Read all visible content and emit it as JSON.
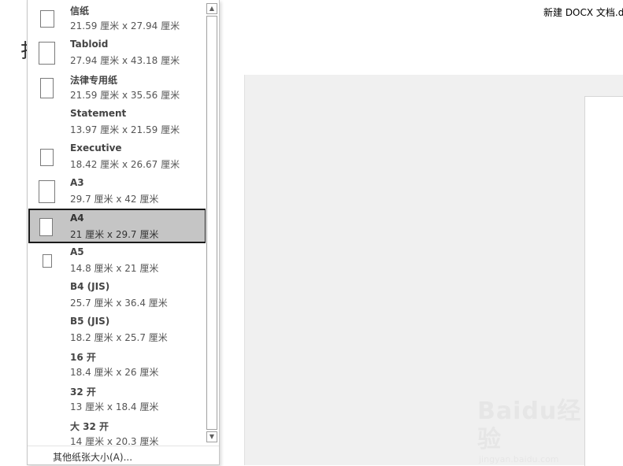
{
  "window": {
    "title": "新建 DOCX 文档.d"
  },
  "background": {
    "left_glyph": "打"
  },
  "paper_sizes": [
    {
      "name": "信纸",
      "size": "21.59 厘米 x 27.94 厘米",
      "selected": false
    },
    {
      "name": "Tabloid",
      "size": "27.94 厘米 x 43.18 厘米",
      "selected": false
    },
    {
      "name": "法律专用纸",
      "size": "21.59 厘米 x 35.56 厘米",
      "selected": false
    },
    {
      "name": "Statement",
      "size": "13.97 厘米 x 21.59 厘米",
      "selected": false
    },
    {
      "name": "Executive",
      "size": "18.42 厘米 x 26.67 厘米",
      "selected": false
    },
    {
      "name": "A3",
      "size": "29.7 厘米 x 42 厘米",
      "selected": false
    },
    {
      "name": "A4",
      "size": "21 厘米 x 29.7 厘米",
      "selected": true
    },
    {
      "name": "A5",
      "size": "14.8 厘米 x 21 厘米",
      "selected": false
    },
    {
      "name": "B4 (JIS)",
      "size": "25.7 厘米 x 36.4 厘米",
      "selected": false
    },
    {
      "name": "B5 (JIS)",
      "size": "18.2 厘米 x 25.7 厘米",
      "selected": false
    },
    {
      "name": "16 开",
      "size": "18.4 厘米 x 26 厘米",
      "selected": false
    },
    {
      "name": "32 开",
      "size": "13 厘米 x 18.4 厘米",
      "selected": false
    },
    {
      "name": "大 32 开",
      "size": "14 厘米 x 20.3 厘米",
      "selected": false
    }
  ],
  "footer": {
    "more_sizes": "其他纸张大小(A)..."
  },
  "scrollbar": {
    "up_icon": "▲",
    "down_icon": "▼"
  },
  "watermark": {
    "main": "Baidu经验",
    "sub": "jingyan.baidu.com"
  },
  "colors": {
    "selected_bg": "#c5c5c5",
    "selected_border": "#1a1a1a"
  }
}
